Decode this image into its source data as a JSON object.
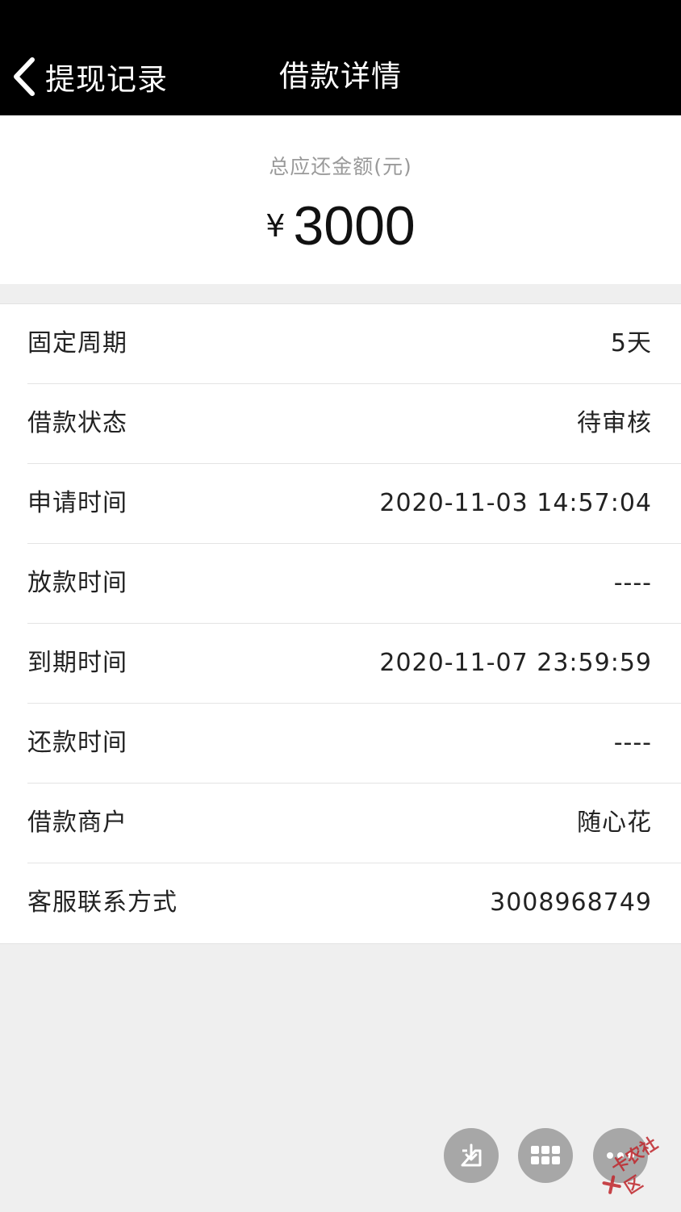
{
  "header": {
    "back_label": "提现记录",
    "title": "借款详情"
  },
  "summary": {
    "label": "总应还金额(元)",
    "currency": "¥",
    "amount": "3000"
  },
  "details": [
    {
      "label": "固定周期",
      "value": "5天"
    },
    {
      "label": "借款状态",
      "value": "待审核"
    },
    {
      "label": "申请时间",
      "value": "2020-11-03 14:57:04"
    },
    {
      "label": "放款时间",
      "value": "----"
    },
    {
      "label": "到期时间",
      "value": "2020-11-07 23:59:59"
    },
    {
      "label": "还款时间",
      "value": "----"
    },
    {
      "label": "借款商户",
      "value": "随心花"
    },
    {
      "label": "客服联系方式",
      "value": "3008968749"
    }
  ],
  "floating_buttons": [
    {
      "icon": "download-icon"
    },
    {
      "icon": "grid-icon"
    },
    {
      "icon": "more-icon"
    }
  ],
  "watermark": {
    "text": "卡农社区"
  },
  "colors": {
    "header_bg": "#000000",
    "page_bg": "#efefef",
    "fab_bg": "#a7a7a7"
  }
}
